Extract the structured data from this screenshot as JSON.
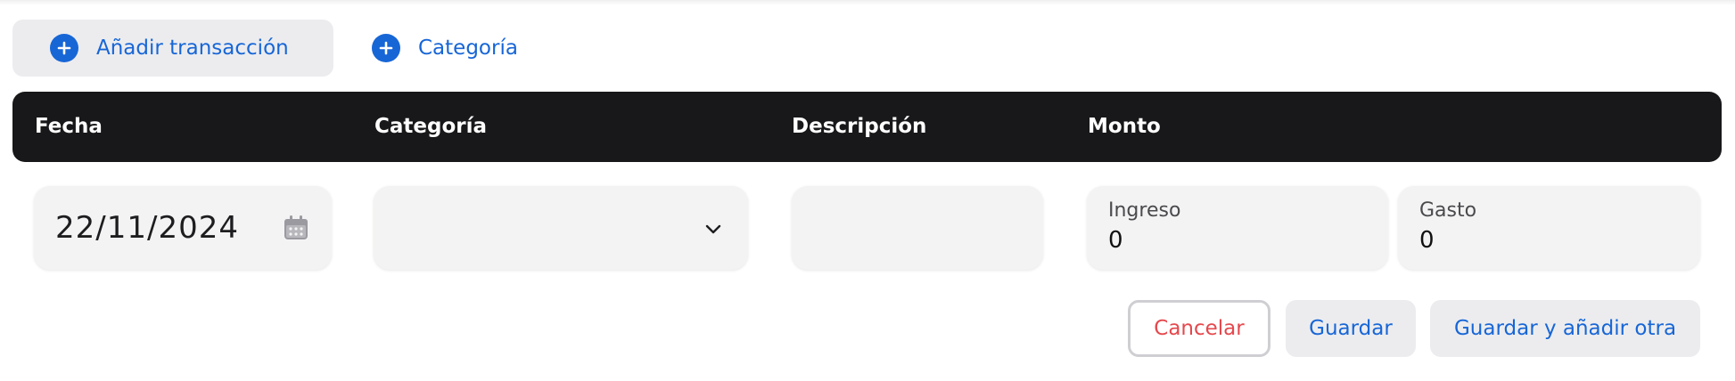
{
  "toolbar": {
    "add_transaction_label": "Añadir transacción",
    "category_label": "Categoría"
  },
  "table_header": {
    "columns": [
      "Fecha",
      "Categoría",
      "Descripción",
      "Monto"
    ]
  },
  "form": {
    "date_value": "22/11/2024",
    "category_value": "",
    "description_value": "",
    "income_label": "Ingreso",
    "income_value": "0",
    "expense_label": "Gasto",
    "expense_value": "0"
  },
  "buttons": {
    "cancel_label": "Cancelar",
    "save_label": "Guardar",
    "save_and_add_label": "Guardar y añadir otra"
  },
  "icons": {
    "plus": "plus-circle-icon",
    "calendar": "calendar-icon",
    "chevron": "chevron-down-icon"
  },
  "colors": {
    "accent": "#1766d6",
    "header_bg": "#18181a",
    "danger": "#e5484d",
    "field_bg": "#f3f3f4"
  }
}
